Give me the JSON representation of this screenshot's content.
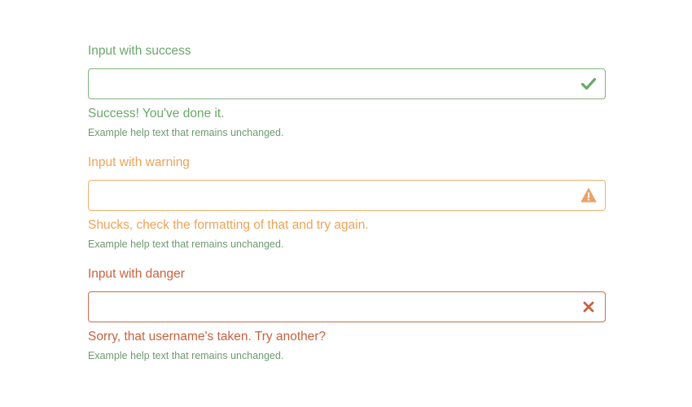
{
  "colors": {
    "success": "#6aa86a",
    "warning": "#efa357",
    "danger": "#c9613f",
    "help_text": "#6f9a72"
  },
  "groups": [
    {
      "state": "success",
      "label": "Input with success",
      "value": "",
      "icon": "checkmark-icon",
      "feedback": "Success! You've done it.",
      "help": "Example help text that remains unchanged."
    },
    {
      "state": "warning",
      "label": "Input with warning",
      "value": "",
      "icon": "warning-triangle-icon",
      "feedback": "Shucks, check the formatting of that and try again.",
      "help": "Example help text that remains unchanged."
    },
    {
      "state": "danger",
      "label": "Input with danger",
      "value": "",
      "icon": "close-x-icon",
      "feedback": "Sorry, that username's taken. Try another?",
      "help": "Example help text that remains unchanged."
    }
  ]
}
